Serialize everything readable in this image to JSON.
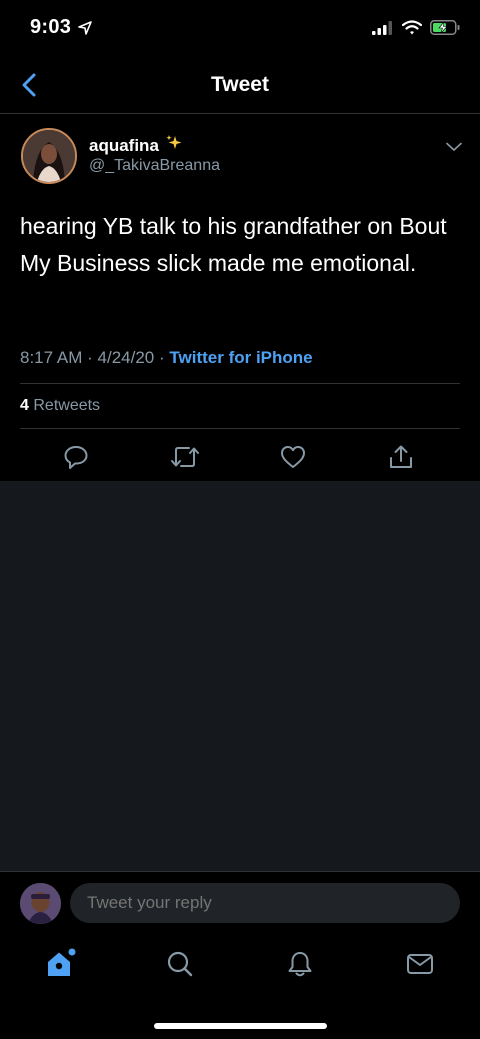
{
  "status_bar": {
    "time": "9:03"
  },
  "nav": {
    "title": "Tweet"
  },
  "tweet": {
    "display_name": "aquafina",
    "handle": "@_TakivaBreanna",
    "text": "hearing YB talk to his grandfather on Bout My Business slick made me emotional.",
    "time": "8:17 AM",
    "separator": "·",
    "date": "4/24/20",
    "source": "Twitter for iPhone",
    "retweet_count": "4",
    "retweet_label": "Retweets"
  },
  "reply": {
    "placeholder": "Tweet your reply"
  },
  "colors": {
    "accent": "#4ea1f3",
    "muted": "#8899a6",
    "background": "#000000",
    "empty_bg": "#15181c"
  },
  "icons": [
    "location-arrow-icon",
    "signal-icon",
    "wifi-icon",
    "battery-icon",
    "back-chevron-icon",
    "sparkles-icon",
    "chevron-down-icon",
    "reply-icon",
    "retweet-icon",
    "like-icon",
    "share-icon",
    "home-icon",
    "search-icon",
    "notifications-icon",
    "messages-icon"
  ]
}
